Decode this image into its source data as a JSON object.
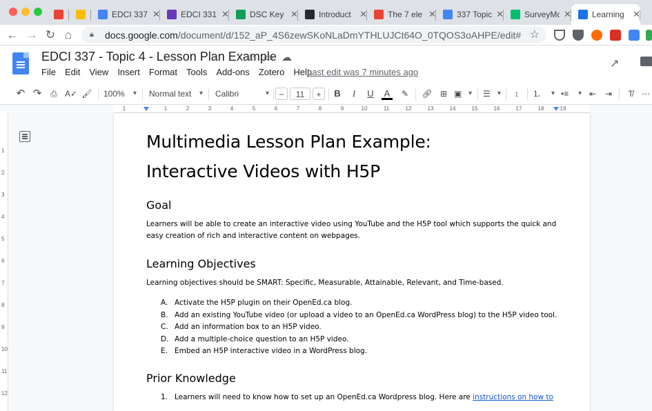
{
  "browser": {
    "tabs": [
      {
        "label": "",
        "icon": "gmail-icon",
        "color": "#ea4335"
      },
      {
        "label": "",
        "icon": "drive-icon",
        "color": "#fbbc04"
      },
      {
        "label": "EDCI 337",
        "icon": "docs-icon",
        "color": "#4285f4"
      },
      {
        "label": "EDCI 331",
        "icon": "forms-icon",
        "color": "#673ab7"
      },
      {
        "label": "DSC Key",
        "icon": "sheets-icon",
        "color": "#0f9d58"
      },
      {
        "label": "Introduct",
        "icon": "github-icon",
        "color": "#24292e"
      },
      {
        "label": "The 7 ele",
        "icon": "chat-icon",
        "color": "#ea4335"
      },
      {
        "label": "337 Topic",
        "icon": "docs-icon",
        "color": "#4285f4"
      },
      {
        "label": "SurveyMo",
        "icon": "surveymonkey-icon",
        "color": "#00bf6f"
      },
      {
        "label": "Learning",
        "icon": "page-icon",
        "color": "#1a73e8"
      }
    ],
    "url_host": "docs.google.com",
    "url_path": "/document/d/152_aP_4S6zewSKoNLaDmYTHLUJCt64O_0TQOS3oAHPE/edit#"
  },
  "doc": {
    "title": "EDCI 337 - Topic 4 - Lesson Plan Example",
    "menu": [
      "File",
      "Edit",
      "View",
      "Insert",
      "Format",
      "Tools",
      "Add-ons",
      "Zotero",
      "Help"
    ],
    "last_edit": "Last edit was 7 minutes ago"
  },
  "toolbar": {
    "zoom": "100%",
    "style": "Normal text",
    "font": "Calibri",
    "font_size": "11"
  },
  "ruler": {
    "numbers": [
      "1",
      "1",
      "2",
      "3",
      "4",
      "5",
      "6",
      "7",
      "8",
      "9",
      "10",
      "11",
      "12",
      "13",
      "14",
      "15",
      "16",
      "17",
      "18",
      "19"
    ],
    "vnumbers": [
      "1",
      "2",
      "3",
      "4",
      "5",
      "6",
      "7",
      "8",
      "9",
      "10",
      "11",
      "12"
    ]
  },
  "content": {
    "title_line1": "Multimedia Lesson Plan Example:",
    "title_line2": "Interactive Videos with H5P",
    "goal_heading": "Goal",
    "goal_text": "Learners will be able to create an interactive video using YouTube and the H5P tool which supports the quick and easy creation of rich and interactive content on webpages.",
    "objectives_heading": "Learning Objectives",
    "objectives_intro": "Learning objectives should be SMART: Specific, Measurable, Attainable, Relevant, and Time-based.",
    "objectives": [
      {
        "mark": "A.",
        "text": "Activate the H5P plugin on their OpenEd.ca blog."
      },
      {
        "mark": "B.",
        "text": "Add an existing YouTube video (or upload a video to an OpenEd.ca WordPress blog) to the H5P video tool."
      },
      {
        "mark": "C.",
        "text": "Add an information box to an H5P video."
      },
      {
        "mark": "D.",
        "text": "Add a multiple-choice question to an H5P video."
      },
      {
        "mark": "E.",
        "text": "Embed an H5P interactive video in a WordPress blog."
      }
    ],
    "prior_heading": "Prior Knowledge",
    "prior_item_mark": "1.",
    "prior_item_text": "Learners will need to know how to set up an OpenEd.ca Wordpress blog. Here are ",
    "prior_item_link": "instructions on how to"
  }
}
